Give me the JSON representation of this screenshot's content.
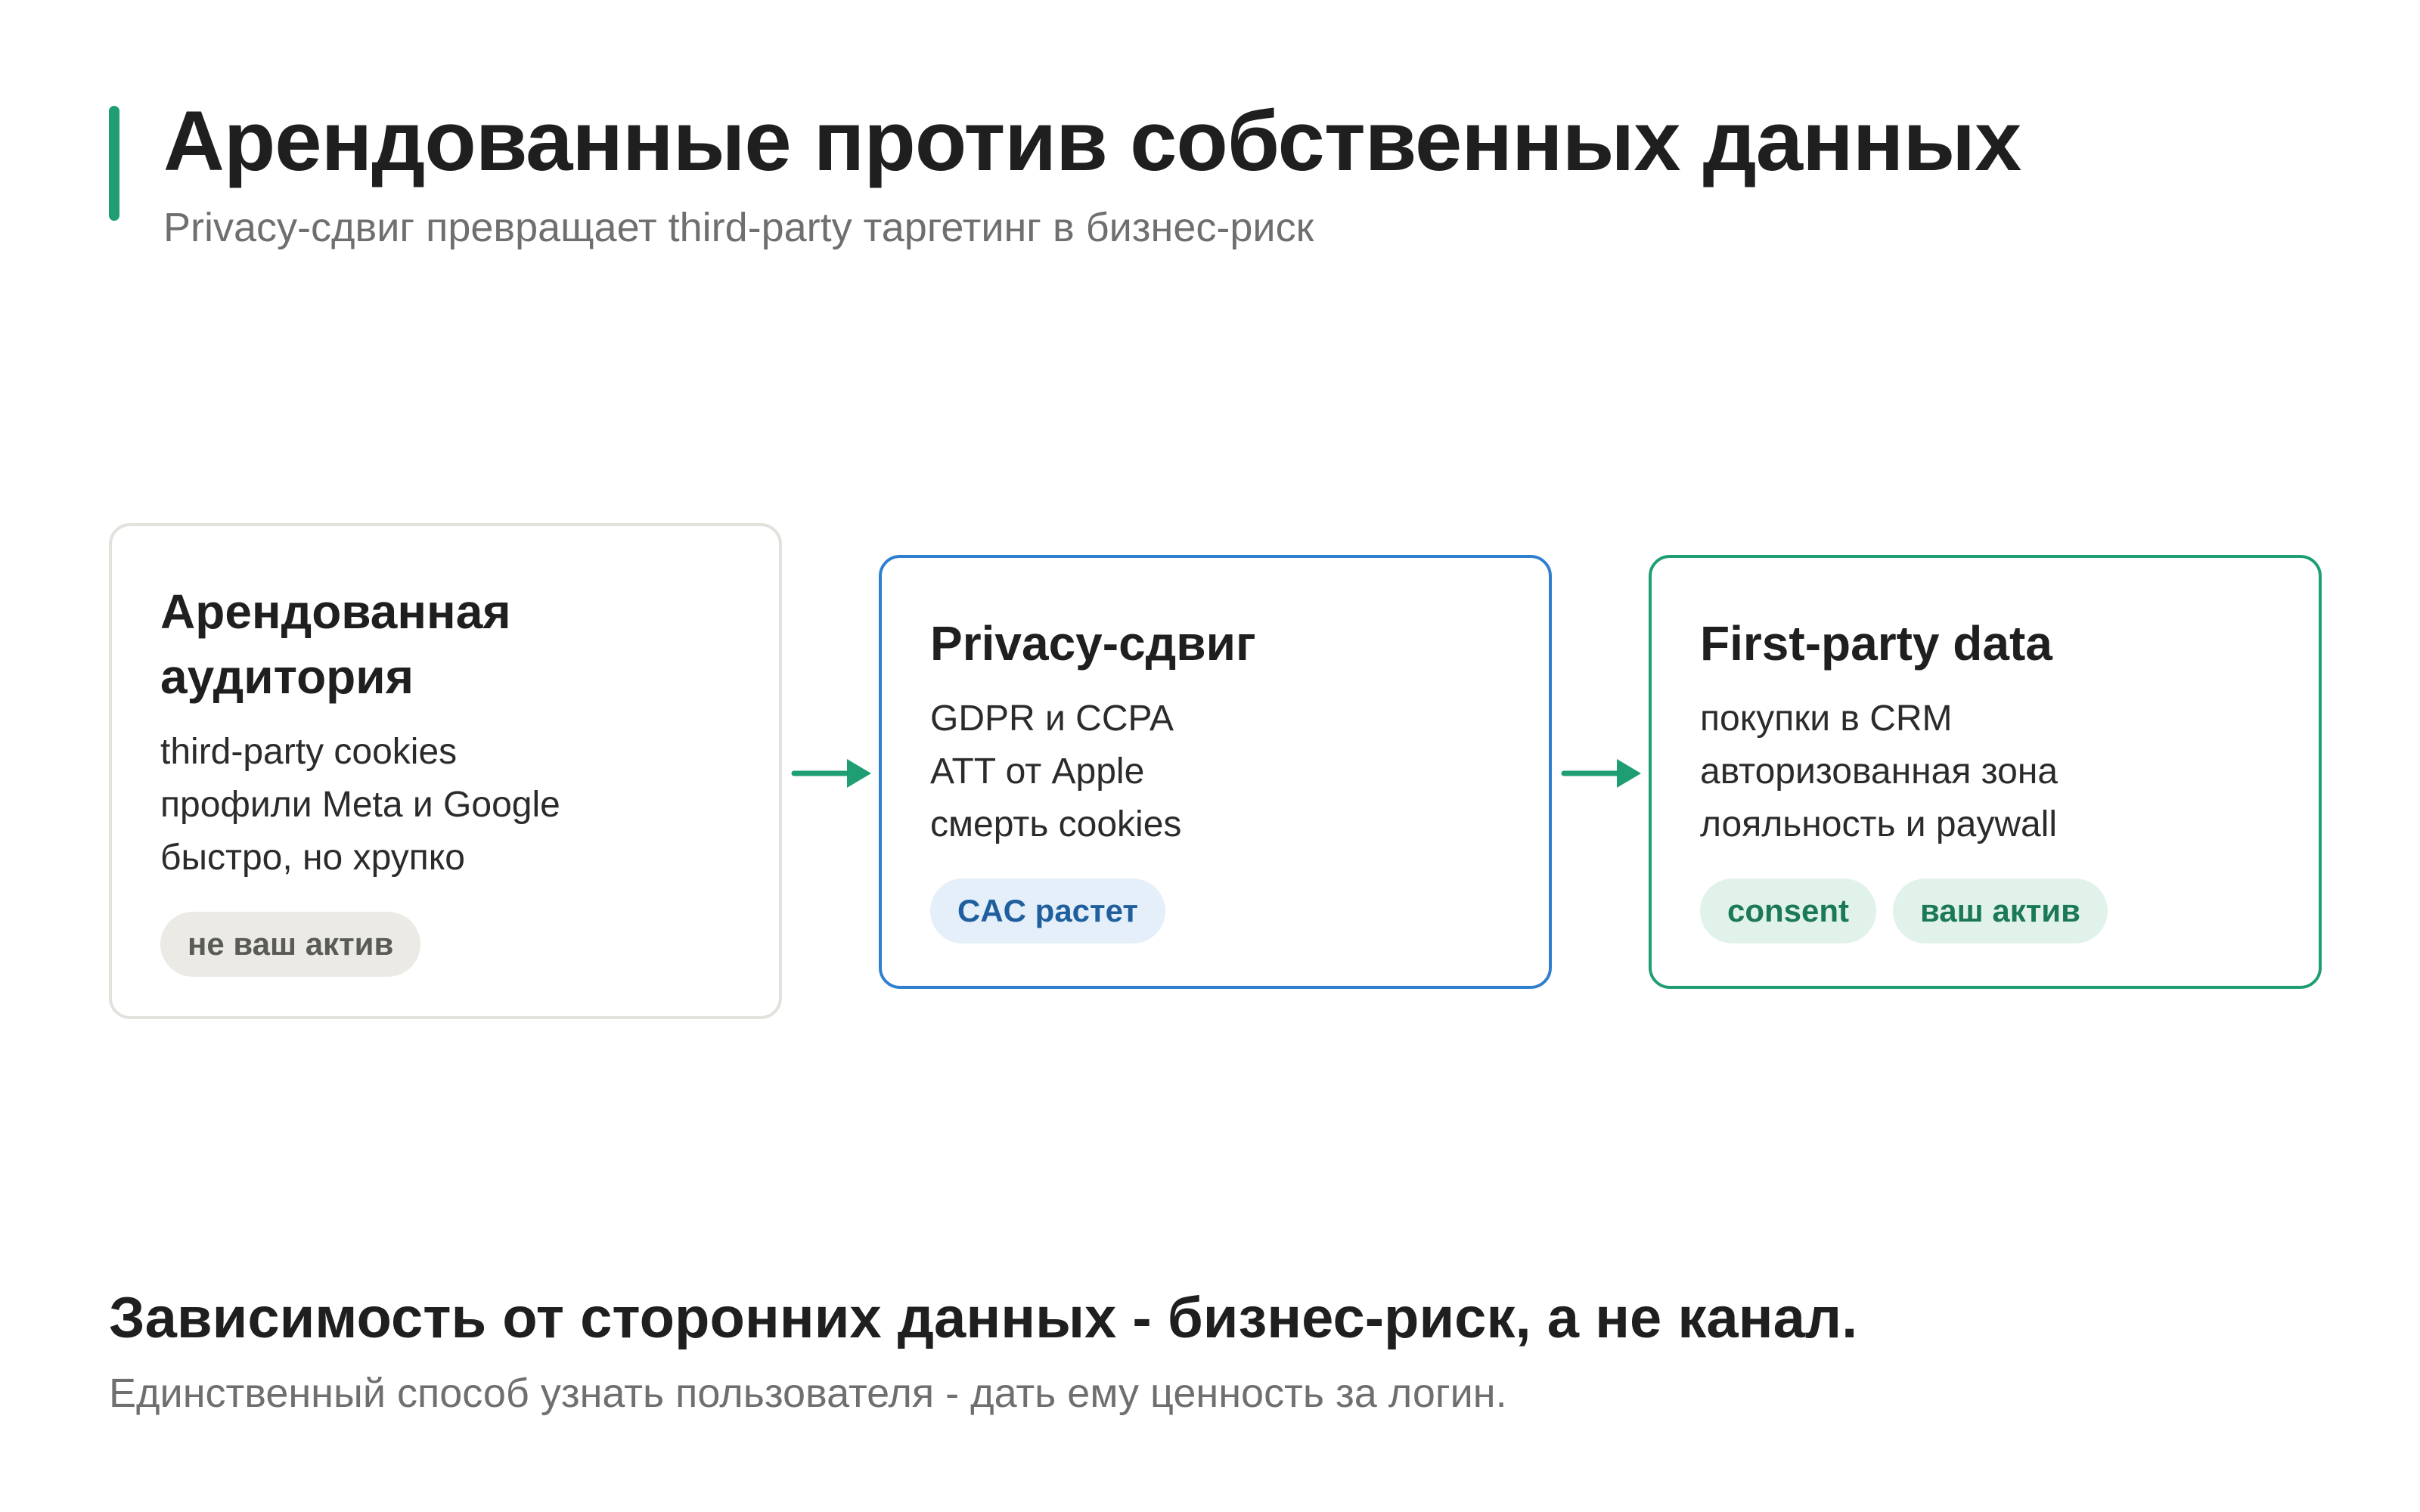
{
  "header": {
    "title": "Арендованные против собственных данных",
    "subtitle": "Privacy-сдвиг превращает third-party таргетинг в бизнес-риск"
  },
  "cards": [
    {
      "title": "Арендованная аудитория",
      "lines": [
        "third-party cookies",
        "профили Meta и Google",
        "быстро, но хрупко"
      ],
      "tags": [
        "не ваш актив"
      ]
    },
    {
      "title": "Privacy-сдвиг",
      "lines": [
        "GDPR и CCPA",
        "ATT от Apple",
        "смерть cookies"
      ],
      "tags": [
        "CAC растет"
      ]
    },
    {
      "title": "First-party data",
      "lines": [
        "покупки в CRM",
        "авторизованная зона",
        "лояльность и paywall"
      ],
      "tags": [
        "consent",
        "ваш актив"
      ]
    }
  ],
  "footer": {
    "takeaway": "Зависимость от сторонних данных - бизнес-риск, а не канал.",
    "note": "Единственный способ узнать пользователя - дать ему ценность за логин."
  },
  "colors": {
    "accent": "#1f9e73",
    "card1_border": "#e2e1dc",
    "card2_border": "#2f7fcf",
    "card3_border": "#1f9e73",
    "arrow": "#1f9e73"
  },
  "icons": {
    "connector": "arrow-right-icon"
  }
}
